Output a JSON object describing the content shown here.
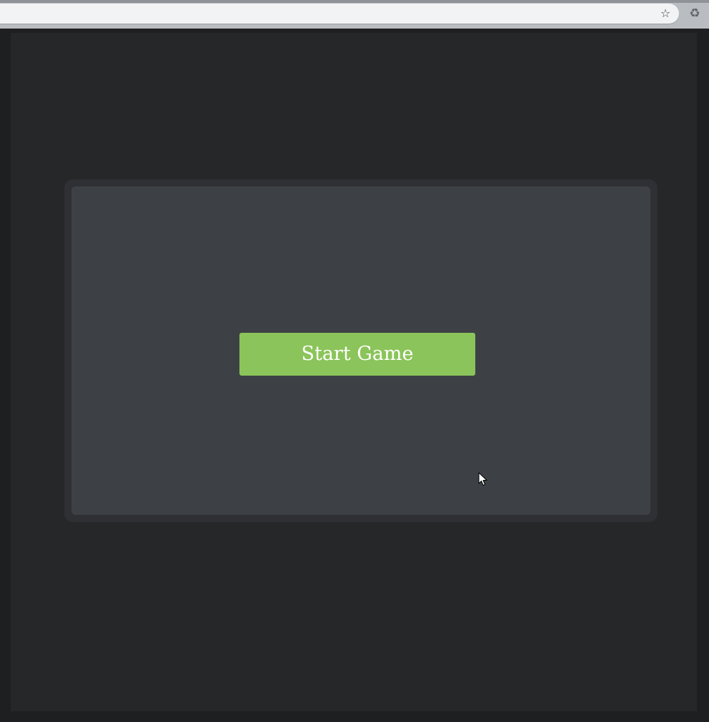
{
  "browser": {
    "toolbar": {
      "star_icon": "star-icon",
      "extension_icon": "recycle-icon"
    }
  },
  "game": {
    "start_button_label": "Start Game"
  },
  "colors": {
    "page_background": "#262729",
    "frame": "#2e3033",
    "canvas": "#3d4145",
    "start_button": "#8bc45a",
    "start_button_text": "#ffffff"
  }
}
